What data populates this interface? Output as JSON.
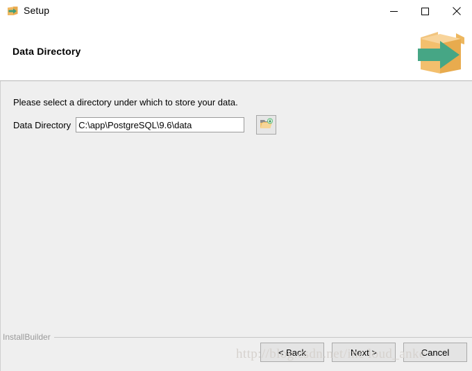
{
  "window": {
    "title": "Setup",
    "icon": "installer-box-arrow-icon",
    "controls": {
      "minimize": "minimize-icon",
      "maximize": "maximize-icon",
      "close": "close-icon"
    }
  },
  "header": {
    "title": "Data Directory",
    "art": "installer-open-box-arrow-graphic"
  },
  "main": {
    "instruction": "Please select a directory under which to store your data.",
    "field": {
      "label": "Data Directory",
      "value": "C:\\app\\PostgreSQL\\9.6\\data",
      "placeholder": "",
      "browse_icon": "folder-browse-icon"
    }
  },
  "footer": {
    "brand": "InstallBuilder",
    "buttons": {
      "back": "< Back",
      "next": "Next >",
      "cancel": "Cancel"
    }
  },
  "overlay": {
    "watermark": "http://blog.csdn.net/inc loud_anke"
  },
  "colors": {
    "body_background": "#efefef",
    "box_orange": "#f0b860",
    "arrow_green": "#4aab8b",
    "button_face": "#e4e4e4",
    "brand_gray": "#9a9a9a"
  }
}
